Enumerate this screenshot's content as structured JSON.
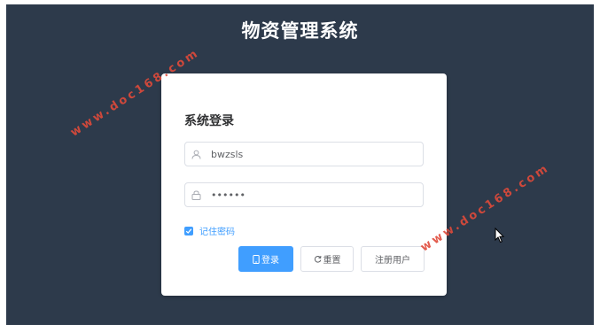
{
  "app": {
    "title": "物资管理系统"
  },
  "login": {
    "heading": "系统登录",
    "username_value": "bwzsls",
    "password_value": "••••••",
    "remember_label": "记住密码",
    "remember_checked": true,
    "buttons": {
      "login": "登录",
      "reset": "重置",
      "register": "注册用户"
    }
  },
  "watermark": "www.doc168.com",
  "icons": [
    "user-icon",
    "lock-icon",
    "checkbox-icon",
    "mobile-icon",
    "refresh-icon"
  ],
  "colors": {
    "background": "#2d3a4b",
    "primary": "#409eff",
    "watermark": "#e04a3a"
  }
}
